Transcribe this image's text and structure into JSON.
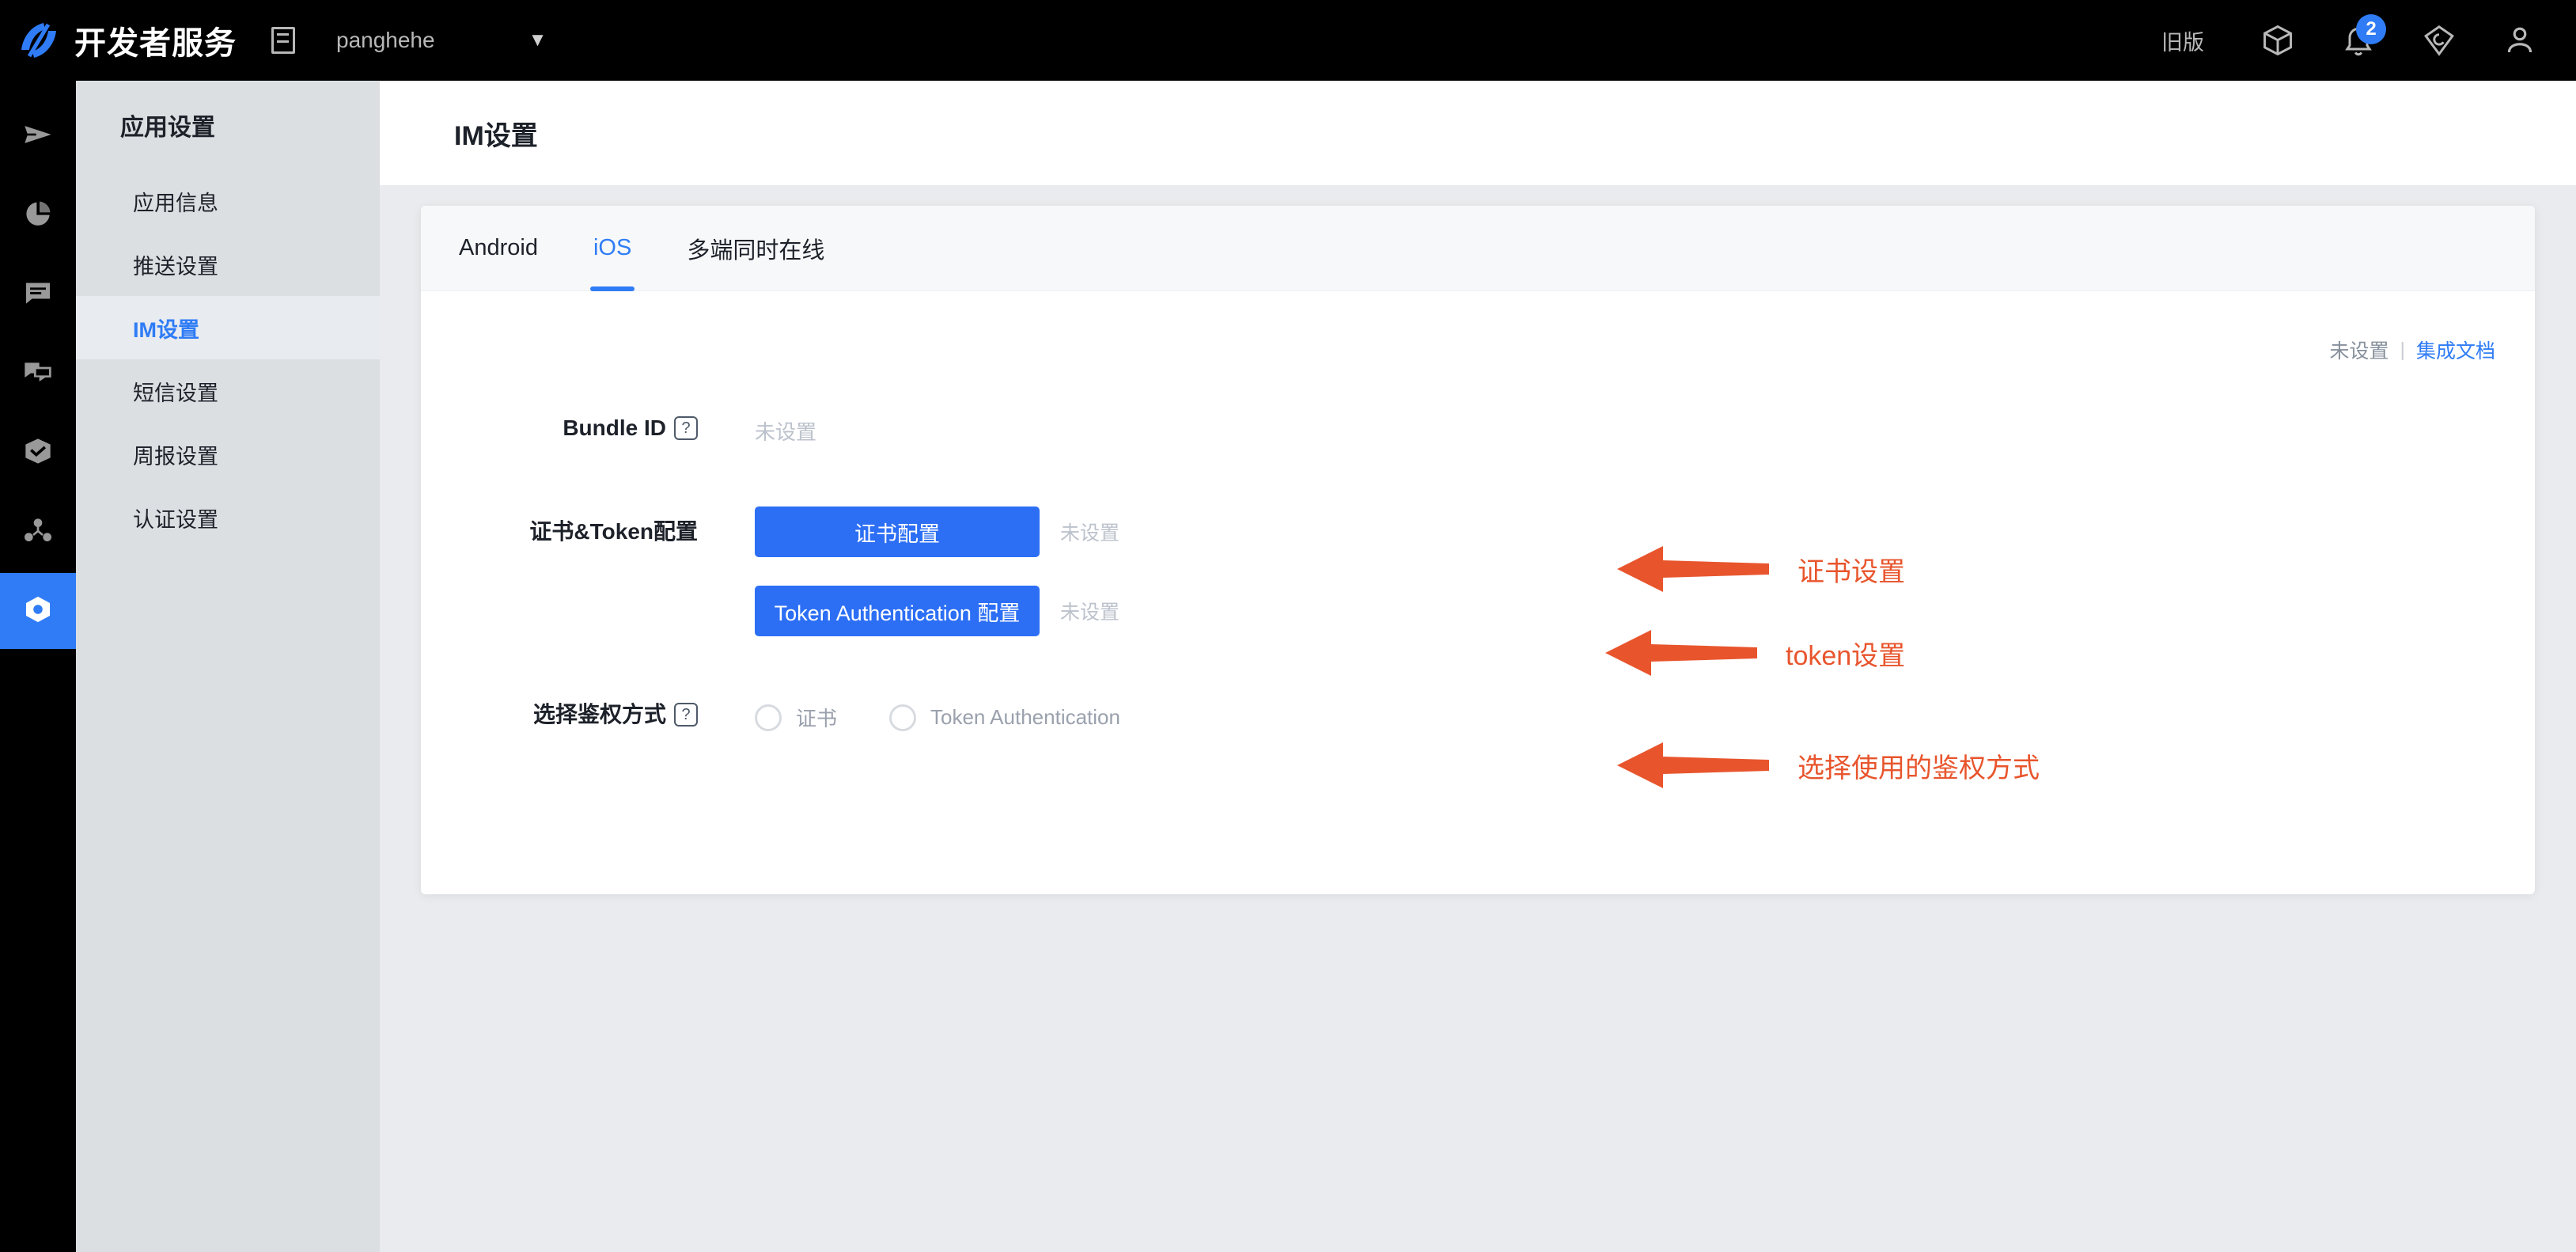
{
  "topbar": {
    "logo_icon": "brand-logo-icon",
    "brand_title": "开发者服务",
    "panel_icon": "panel-toggle-icon",
    "workspace_name": "panghehe",
    "workspace_caret_icon": "chevron-down-icon",
    "legacy_label": "旧版",
    "cube_icon": "cube-icon",
    "bell_icon": "bell-icon",
    "bell_badge": "2",
    "gem_icon": "gem-icon",
    "user_icon": "user-avatar-icon",
    "bg_color": "#000000"
  },
  "rail": {
    "items": [
      {
        "icon": "paper-plane-icon",
        "active": false
      },
      {
        "icon": "pie-chart-icon",
        "active": false
      },
      {
        "icon": "chat-bubble-icon",
        "active": false
      },
      {
        "icon": "chat-bubbles-icon",
        "active": false
      },
      {
        "icon": "box-check-icon",
        "active": false
      },
      {
        "icon": "share-nodes-icon",
        "active": false
      },
      {
        "icon": "hexagon-settings-icon",
        "active": true
      }
    ],
    "active_color": "#2f7cf6"
  },
  "sidebar": {
    "header": "应用设置",
    "items": [
      {
        "label": "应用信息",
        "active": false
      },
      {
        "label": "推送设置",
        "active": false
      },
      {
        "label": "IM设置",
        "active": true
      },
      {
        "label": "短信设置",
        "active": false
      },
      {
        "label": "周报设置",
        "active": false
      },
      {
        "label": "认证设置",
        "active": false
      }
    ],
    "active_color": "#2f7cf6"
  },
  "page": {
    "title": "IM设置"
  },
  "tabs": [
    {
      "label": "Android",
      "active": false
    },
    {
      "label": "iOS",
      "active": true
    },
    {
      "label": "多端同时在线",
      "active": false
    }
  ],
  "status_row": {
    "unset_label": "未设置",
    "separator": "|",
    "doc_link": "集成文档",
    "link_color": "#2f7cf6"
  },
  "form": {
    "bundle_id": {
      "label": "Bundle ID",
      "help_icon": "help-question-icon",
      "value": "未设置"
    },
    "cert_token": {
      "label": "证书&Token配置",
      "cert_button": "证书配置",
      "cert_status": "未设置",
      "token_button": "Token Authentication 配置",
      "token_status": "未设置",
      "button_color": "#2c6ff5"
    },
    "auth_method": {
      "label": "选择鉴权方式",
      "help_icon": "help-question-icon",
      "options": [
        {
          "label": "证书",
          "selected": false
        },
        {
          "label": "Token Authentication",
          "selected": false
        }
      ]
    }
  },
  "annotations": {
    "color": "#e8552d",
    "items": [
      {
        "icon": "left-arrow-icon",
        "text": "证书设置"
      },
      {
        "icon": "left-arrow-icon",
        "text": "token设置"
      },
      {
        "icon": "left-arrow-icon",
        "text": "选择使用的鉴权方式"
      }
    ]
  }
}
